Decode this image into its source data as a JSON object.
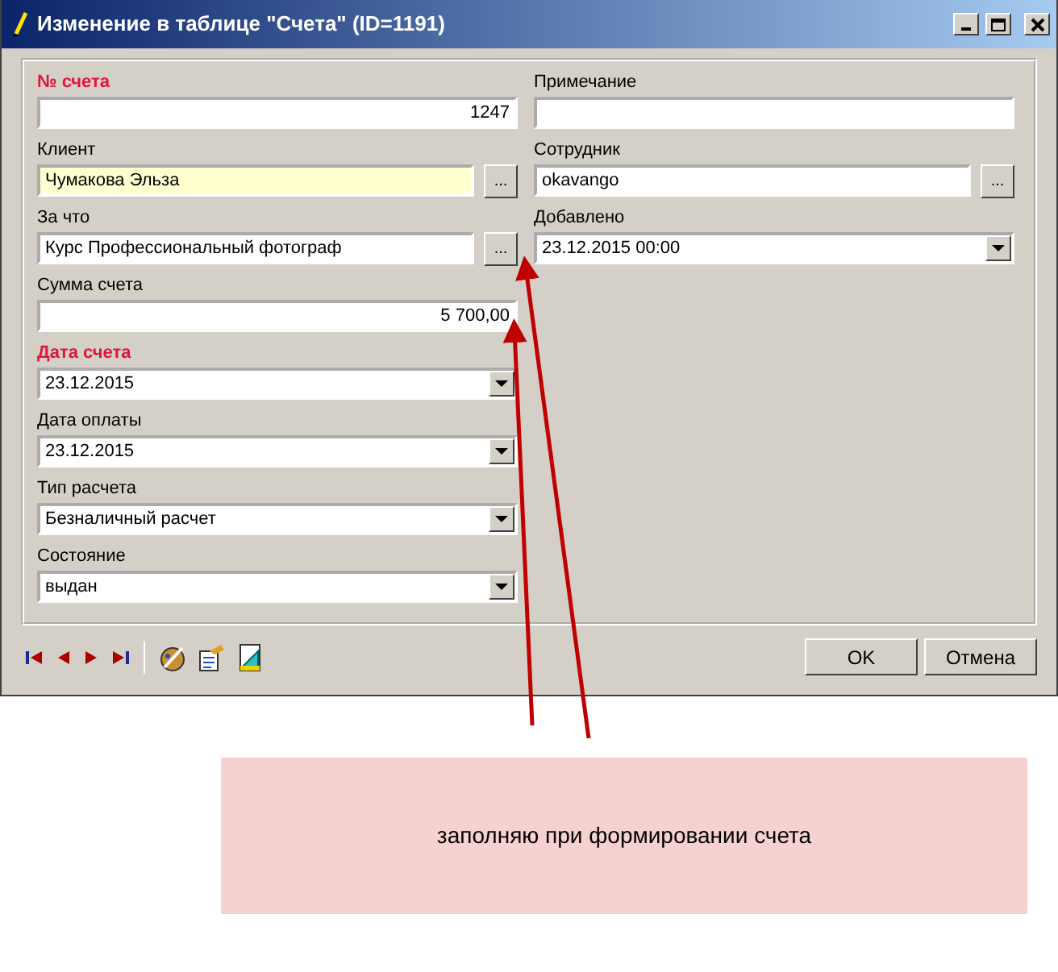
{
  "window": {
    "title": "Изменение в таблице \"Счета\" (ID=1191)"
  },
  "columns": [
    {
      "fields": [
        {
          "label": "№ счета",
          "required": true,
          "kind": "number",
          "value": "1247",
          "highlighted": false
        },
        {
          "label": "Клиент",
          "required": false,
          "kind": "lookup",
          "value": "Чумакова Эльза",
          "button": "...",
          "highlighted": true
        },
        {
          "label": "За что",
          "required": false,
          "kind": "lookup",
          "value": "Курс Профессиональный фотограф",
          "button": "...",
          "highlighted": false
        },
        {
          "label": "Сумма счета",
          "required": false,
          "kind": "number",
          "value": "5 700,00",
          "highlighted": false
        },
        {
          "label": "Дата счета",
          "required": true,
          "kind": "combo",
          "value": "23.12.2015",
          "highlighted": false
        },
        {
          "label": "Дата оплаты",
          "required": false,
          "kind": "combo",
          "value": "23.12.2015",
          "highlighted": false
        },
        {
          "label": "Тип расчета",
          "required": false,
          "kind": "combo",
          "value": "Безналичный расчет",
          "highlighted": false
        },
        {
          "label": "Состояние",
          "required": false,
          "kind": "combo",
          "value": "выдан",
          "highlighted": false
        }
      ]
    },
    {
      "fields": [
        {
          "label": "Примечание",
          "required": false,
          "kind": "text",
          "highlighted": false
        },
        {
          "label": "Сотрудник",
          "required": false,
          "kind": "lookup",
          "value": "okavango",
          "button": "...",
          "highlighted": false
        },
        {
          "label": "Добавлено",
          "required": false,
          "kind": "combo",
          "value": "23.12.2015 00:00",
          "highlighted": false
        }
      ]
    }
  ],
  "buttons": [
    "OK",
    "Отмена"
  ],
  "note": {
    "text": "заполняю при формировании счета"
  }
}
